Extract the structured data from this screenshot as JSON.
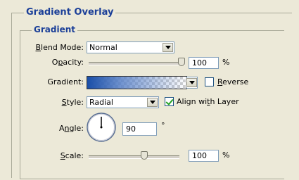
{
  "panel": {
    "title": "Gradient Overlay",
    "section": "Gradient"
  },
  "blend_mode": {
    "label_prefix": "B",
    "label_rest": "lend Mode:",
    "value": "Normal"
  },
  "opacity": {
    "label_pre": "O",
    "label_u": "p",
    "label_post": "acity:",
    "value": "100",
    "unit": "%",
    "level_percent": 100
  },
  "gradient": {
    "label": "Gradient:",
    "colors": [
      "#1a4fa8",
      "#ffffff"
    ]
  },
  "reverse": {
    "label_u": "R",
    "label_rest": "everse",
    "checked": false
  },
  "style": {
    "label_u": "S",
    "label_rest": "tyle:",
    "value": "Radial"
  },
  "align": {
    "label_pre": "Align wi",
    "label_u": "t",
    "label_post": "h Layer",
    "checked": true
  },
  "angle": {
    "label_pre": "A",
    "label_u": "n",
    "label_post": "gle:",
    "value": "90",
    "unit": "°"
  },
  "scale": {
    "label_u": "S",
    "label_rest": "cale:",
    "value": "100",
    "unit": "%",
    "level_percent": 100
  }
}
